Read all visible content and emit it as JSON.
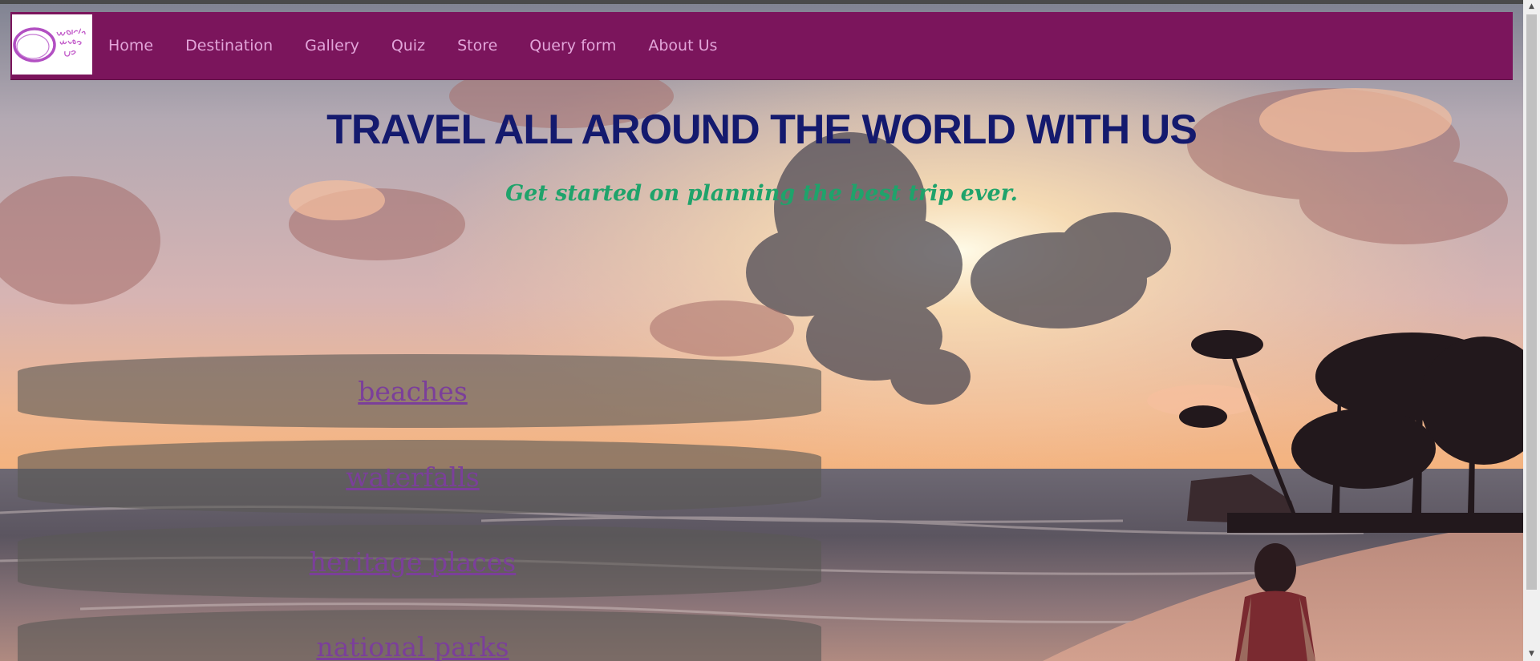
{
  "nav": {
    "logo_text": "World Upon Us",
    "links": [
      {
        "label": "Home"
      },
      {
        "label": "Destination"
      },
      {
        "label": "Gallery"
      },
      {
        "label": "Quiz"
      },
      {
        "label": "Store"
      },
      {
        "label": "Query form"
      },
      {
        "label": "About Us"
      }
    ]
  },
  "hero": {
    "title": "TRAVEL ALL AROUND THE WORLD WITH US",
    "subtitle": "Get started on planning the best trip ever."
  },
  "categories": [
    {
      "label": "beaches"
    },
    {
      "label": "waterfalls"
    },
    {
      "label": "heritage places"
    },
    {
      "label": "national parks"
    }
  ],
  "colors": {
    "nav_bg": "#7b155c",
    "nav_link": "#e2a4d9",
    "title": "#141a6e",
    "subtitle": "#1fa36b",
    "category_link": "#7b3f9a"
  }
}
